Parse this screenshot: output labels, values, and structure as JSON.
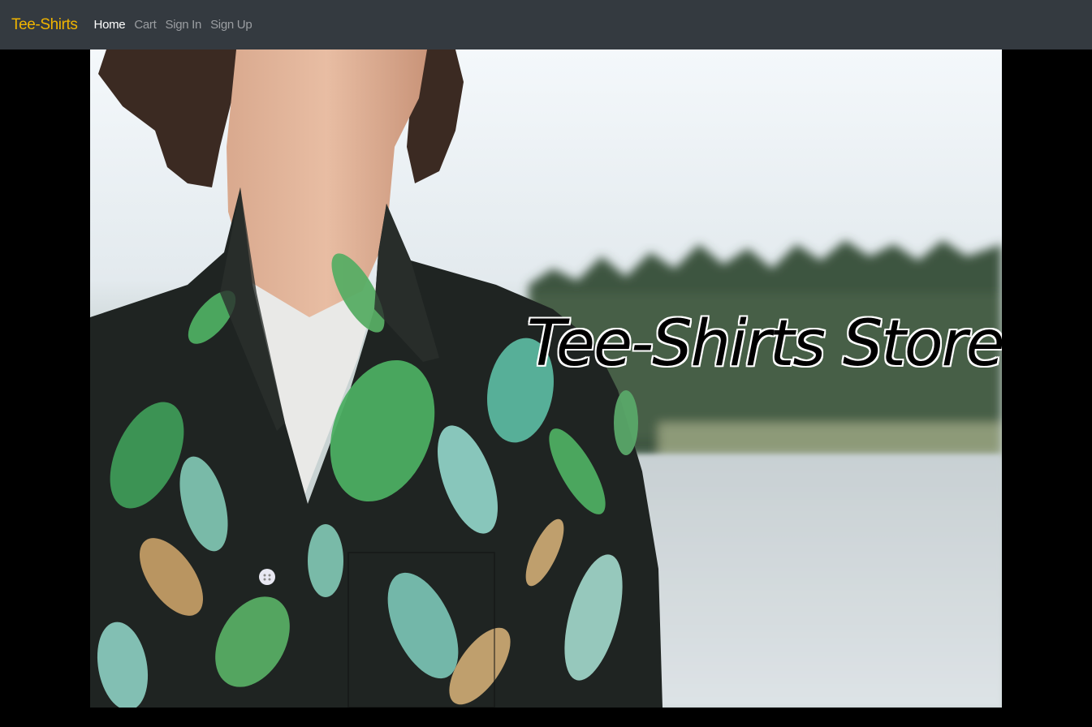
{
  "navbar": {
    "brand": "Tee-Shirts",
    "links": [
      {
        "label": "Home",
        "active": true
      },
      {
        "label": "Cart",
        "active": false
      },
      {
        "label": "Sign In",
        "active": false
      },
      {
        "label": "Sign Up",
        "active": false
      }
    ]
  },
  "hero": {
    "title": "Tee-Shirts Store"
  },
  "colors": {
    "navbar_bg": "#343a40",
    "brand": "#f0b400",
    "nav_active": "#ffffff",
    "nav_inactive": "#9a9da1",
    "page_bg": "#000000"
  }
}
